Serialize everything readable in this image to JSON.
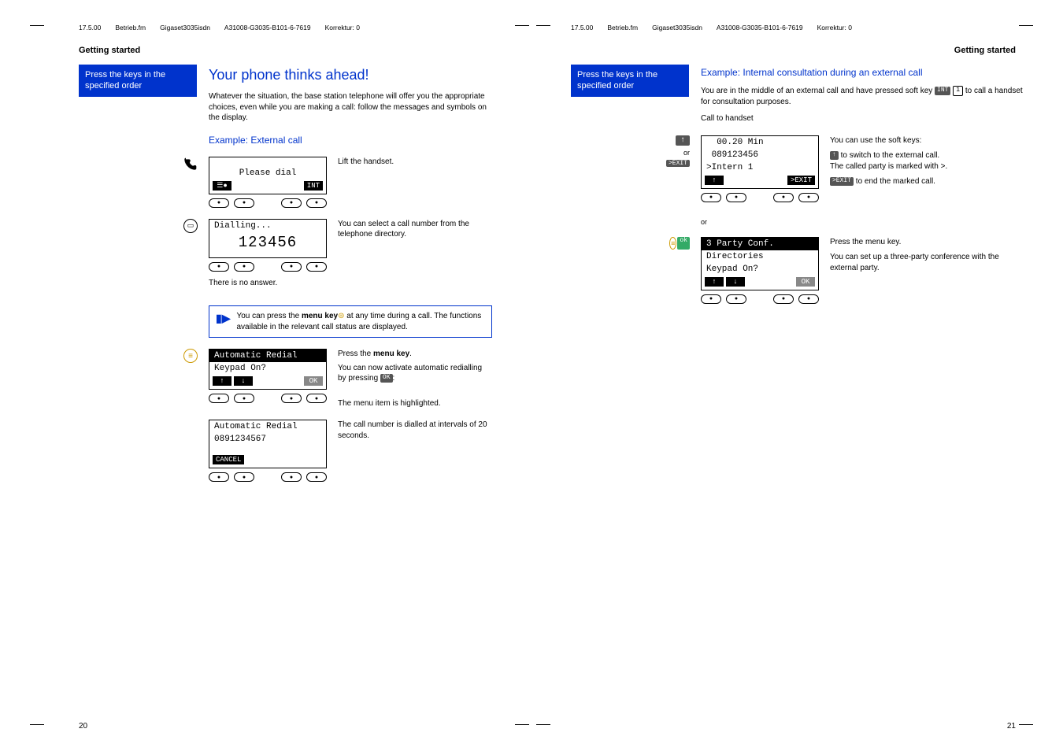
{
  "header": {
    "date": "17.5.00",
    "file": "Betrieb.fm",
    "product": "Gigaset3035isdn",
    "doc": "A31008-G3035-B101-6-7619",
    "korr": "Korrektur: 0"
  },
  "left_page": {
    "section": "Getting started",
    "tab": "Press the keys in the specified order",
    "h1": "Your phone thinks ahead!",
    "intro": "Whatever the situation, the base station telephone will offer you the appropriate choices, even while you are making a call: follow the messages and symbols on the display.",
    "ex1_title": "Example: External call",
    "lift": "Lift the handset.",
    "lcd1_line": "Please dial",
    "lcd1_sk_left": "☰●",
    "lcd1_sk_right": "INT",
    "dir_text": "You can select a call number from the telephone directory.",
    "lcd2_line1": "Dialling...",
    "lcd2_line2": "123456",
    "no_answer": "There is no answer.",
    "infobox_prefix": "You can press the ",
    "infobox_bold": "menu key",
    "infobox_suffix1": " at any time during a call. The functions available in the relevant call status are displayed.",
    "press_menu": "Press the ",
    "press_menu_bold": "menu key",
    "press_menu_after": ".",
    "activate": "You can now activate automatic redialling by pressing ",
    "activate_key": "OK",
    "activate_after": ":",
    "highlighted": "The menu item is highlighted.",
    "redial_text": "The call number is dialled at intervals of 20 seconds.",
    "lcd3_line1": "Automatic Redial",
    "lcd3_line2": "Keypad On?",
    "lcd3_sk_up": "↑",
    "lcd3_sk_dn": "↓",
    "lcd3_sk_ok": "OK",
    "lcd4_line1": "Automatic Redial",
    "lcd4_line2": "0891234567",
    "lcd4_sk": "CANCEL",
    "pagenum": "20"
  },
  "right_page": {
    "section": "Getting started",
    "tab": "Press the keys in the specified order",
    "ex_title": "Example: Internal consultation during an external call",
    "intro_a": "You are in the middle of an external call and have pressed soft key ",
    "intro_key1": "INT",
    "intro_key2": "1",
    "intro_b": " to call a handset for consultation purposes.",
    "call_to": "Call to handset",
    "icon_or": "or",
    "icon_exit": ">EXIT",
    "lcd1_l1": "  00.20 Min",
    "lcd1_l2": " 089123456",
    "lcd1_l3": ">Intern 1",
    "lcd1_sk_left": "↑",
    "lcd1_sk_right": ">EXIT",
    "use_soft": "You can use the soft keys:",
    "switch_a": " to switch to the external call.",
    "switch_b": "The called party is marked with >.",
    "end_call": " to end the marked call.",
    "or": "or",
    "lcd2_l1": "3 Party Conf.",
    "lcd2_l2": "Directories",
    "lcd2_l3": "Keypad On?",
    "lcd2_sk_up": "↑",
    "lcd2_sk_dn": "↓",
    "lcd2_sk_ok": "OK",
    "press_menu": "Press the menu key.",
    "three_party": "You can set up a three-party conference with the external party.",
    "pagenum": "21"
  }
}
